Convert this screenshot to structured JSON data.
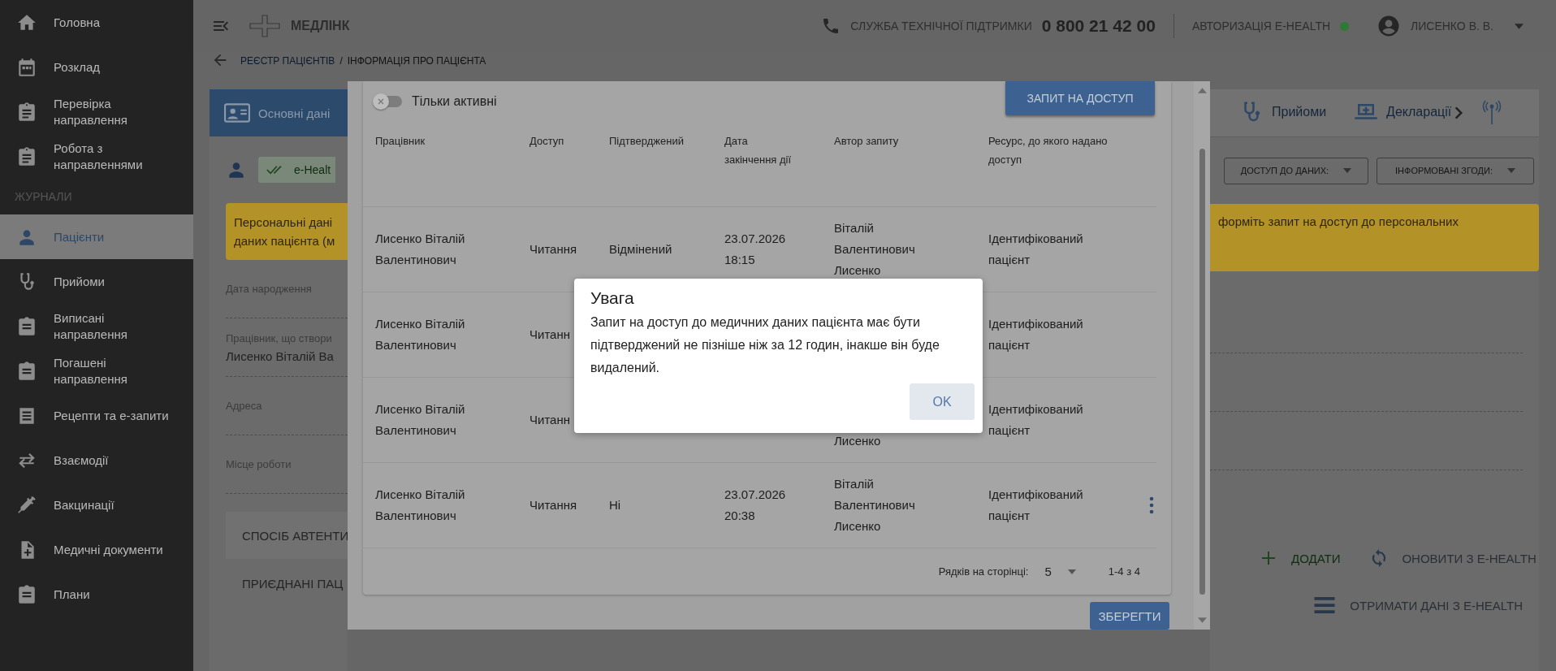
{
  "sidebar": {
    "items": [
      {
        "label": "Головна",
        "selected": false
      },
      {
        "label": "Розклад",
        "selected": false
      },
      {
        "label": "Перевірка направлення",
        "selected": false
      },
      {
        "label": "Робота з направленнями",
        "selected": false
      }
    ],
    "section": {
      "heading": "ЖУРНАЛИ",
      "items": [
        {
          "label": "Пацієнти",
          "selected": true
        },
        {
          "label": "Прийоми",
          "selected": false
        },
        {
          "label": "Виписані направлення",
          "selected": false
        },
        {
          "label": "Погашені направлення",
          "selected": false
        },
        {
          "label": "Рецепти та е-запити",
          "selected": false
        },
        {
          "label": "Взаємодії",
          "selected": false
        },
        {
          "label": "Вакцинації",
          "selected": false
        },
        {
          "label": "Медичні документи",
          "selected": false
        },
        {
          "label": "Плани",
          "selected": false
        }
      ]
    }
  },
  "header": {
    "brand": "МЕДЛІНК",
    "support_label": "СЛУЖБА ТЕХНІЧНОЇ ПІДТРИМКИ",
    "support_phone": "0 800 21 42 00",
    "auth_label": "АВТОРИЗАЦІЯ E-HEALTH",
    "auth_connected": true,
    "user": "ЛИСЕНКО В. В."
  },
  "breadcrumb": {
    "items": [
      "РЕЄСТР ПАЦІЄНТІВ",
      "ІНФОРМАЦІЯ ПРО ПАЦІЄНТА"
    ],
    "separator": "/"
  },
  "patient_page": {
    "tabs_left": [
      {
        "label": "Основні дані",
        "selected": true
      }
    ],
    "tabs_right": [
      {
        "label": "Прийоми",
        "selected": false
      },
      {
        "label": "Декларації",
        "selected": false
      }
    ],
    "ehealth_chip": "e-Healt",
    "banner_left": [
      "Персональні дані",
      "даних пацієнта (м"
    ],
    "banner_right": "форміть запит на доступ до персональних",
    "filters": [
      "ДОСТУП ДО ДАНИХ:",
      "ІНФОРМОВАНІ ЗГОДИ:"
    ],
    "fields": [
      {
        "label": "Дата народження"
      },
      {
        "label": "Працівник, що створи",
        "value": "Лисенко Віталій Ва"
      },
      {
        "label": "Адреса"
      },
      {
        "label": "Місце роботи"
      }
    ],
    "sections": [
      "СПОСІБ АВТЕНТИ",
      "ПРИЄДНАНІ ПАЦ"
    ],
    "actions": [
      {
        "kind": "add",
        "label": "ДОДАТИ"
      },
      {
        "kind": "refresh",
        "label": "ОНОВИТИ З E-HEALTH"
      }
    ],
    "fetch_action": {
      "kind": "fetch",
      "label": "ОТРИМАТИ ДАНІ З E-HEALTH"
    }
  },
  "access_dialog": {
    "only_active": {
      "label": "Тільки активні",
      "on": false
    },
    "request_button": "ЗАПИТ НА ДОСТУП",
    "columns": [
      "Працівник",
      "Доступ",
      "Підтверджений",
      "Дата закінчення дії",
      "Автор запиту",
      "Ресурс, до якого надано доступ"
    ],
    "rows": [
      {
        "worker": "Лисенко Віталій Валентинович",
        "access": "Читання",
        "confirmed": "Відмінений",
        "expires": "23.07.2026 18:15",
        "author": "Віталій Валентинович Лисенко",
        "resource": "Ідентифікований пацієнт",
        "menu": false
      },
      {
        "worker": "Лисенко Віталій Валентинович",
        "access": "Читанн",
        "resource": "Ідентифікований пацієнт",
        "menu": false
      },
      {
        "worker": "Лисенко Віталій Валентинович",
        "access": "Читанн",
        "author": "Лисенко",
        "resource": "Ідентифікований пацієнт",
        "menu": false
      },
      {
        "worker": "Лисенко Віталій Валентинович",
        "access": "Читання",
        "confirmed": "Ні",
        "expires": "23.07.2026 20:38",
        "author": "Віталій Валентинович Лисенко",
        "resource": "Ідентифікований пацієнт",
        "menu": true
      }
    ],
    "rows_per_page_label": "Рядків на сторінці:",
    "rows_per_page": "5",
    "range": "1-4 з 4",
    "save_button": "ЗБЕРЕГТИ"
  },
  "alert": {
    "title": "Увага",
    "message": "Запит на доступ до медичних даних пацієнта має бути підтверджений не пізніше ніж за 12 годин, інакше він буде видалений.",
    "ok": "OK"
  }
}
